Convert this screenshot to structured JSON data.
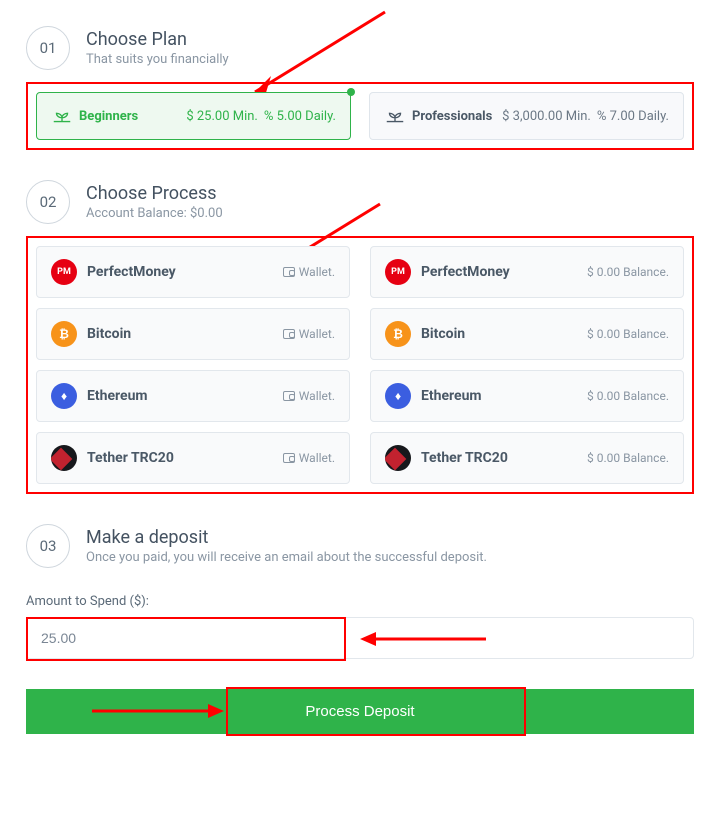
{
  "steps": {
    "s1": {
      "num": "01",
      "title": "Choose Plan",
      "sub": "That suits you financially"
    },
    "s2": {
      "num": "02",
      "title": "Choose Process",
      "sub": "Account Balance: $0.00"
    },
    "s3": {
      "num": "03",
      "title": "Make a deposit",
      "sub": "Once you paid, you will receive an email about the successful deposit."
    }
  },
  "plans": {
    "a": {
      "name": "Beginners",
      "min": "$ 25.00 Min.",
      "daily": "% 5.00 Daily."
    },
    "b": {
      "name": "Professionals",
      "min": "$ 3,000.00 Min.",
      "daily": "% 7.00 Daily."
    }
  },
  "proc": {
    "pm": {
      "name": "PerfectMoney",
      "left": "Wallet.",
      "right": "$ 0.00 Balance."
    },
    "btc": {
      "name": "Bitcoin",
      "left": "Wallet.",
      "right": "$ 0.00 Balance."
    },
    "eth": {
      "name": "Ethereum",
      "left": "Wallet.",
      "right": "$ 0.00 Balance."
    },
    "trc": {
      "name": "Tether TRC20",
      "left": "Wallet.",
      "right": "$ 0.00 Balance."
    }
  },
  "amount": {
    "label": "Amount to Spend ($):",
    "value": "25.00"
  },
  "submit": {
    "label": "Process Deposit"
  }
}
